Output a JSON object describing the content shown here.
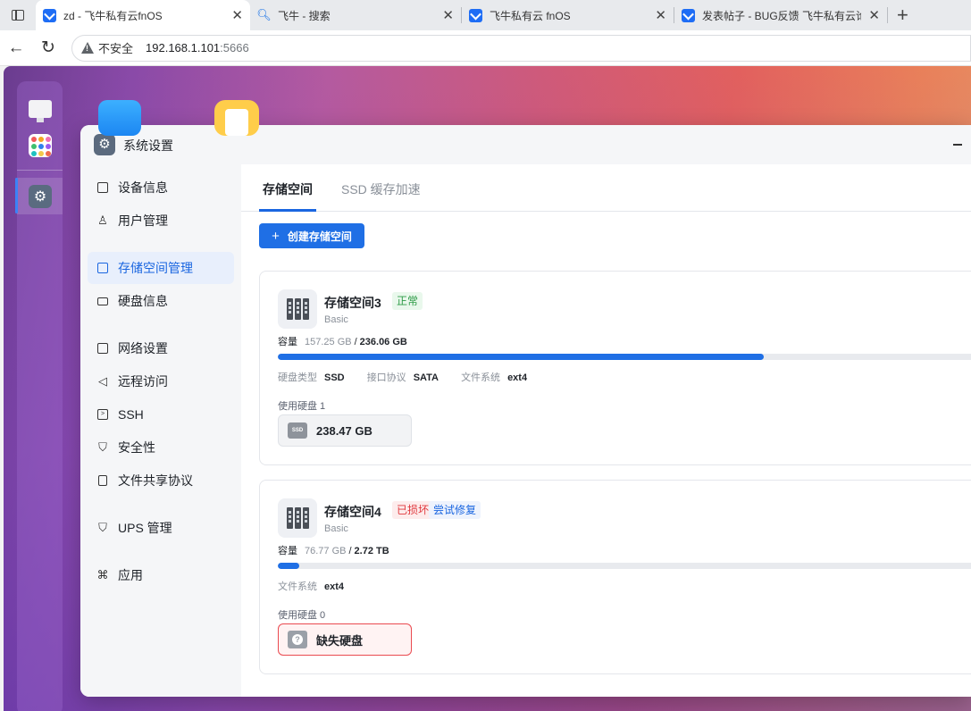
{
  "browser": {
    "tabs": [
      {
        "title": "zd - 飞牛私有云fnOS",
        "active": true
      },
      {
        "title": "飞牛 - 搜索",
        "active": false
      },
      {
        "title": "飞牛私有云 fnOS",
        "active": false
      },
      {
        "title": "发表帖子 - BUG反馈 飞牛私有云论",
        "active": false
      }
    ],
    "security_label": "不安全",
    "url_host": "192.168.1.101",
    "url_port": ":5666"
  },
  "window": {
    "title": "系统设置"
  },
  "sidebar": {
    "items": [
      {
        "label": "设备信息",
        "icon": "device-icon"
      },
      {
        "label": "用户管理",
        "icon": "user-icon"
      },
      {
        "label": "存储空间管理",
        "icon": "storage-icon",
        "active": true
      },
      {
        "label": "硬盘信息",
        "icon": "disk-icon"
      },
      {
        "label": "网络设置",
        "icon": "network-icon"
      },
      {
        "label": "远程访问",
        "icon": "remote-icon"
      },
      {
        "label": "SSH",
        "icon": "terminal-icon"
      },
      {
        "label": "安全性",
        "icon": "shield-icon"
      },
      {
        "label": "文件共享协议",
        "icon": "file-icon"
      },
      {
        "label": "UPS 管理",
        "icon": "ups-icon"
      },
      {
        "label": "应用",
        "icon": "apps-icon"
      }
    ]
  },
  "content": {
    "tabs": [
      "存储空间",
      "SSD 缓存加速"
    ],
    "create_button": "创建存储空间",
    "pools": [
      {
        "name": "存储空间3",
        "status": "正常",
        "type": "Basic",
        "capacity_label": "容量",
        "used": "157.25 GB",
        "total": "236.06 GB",
        "usage_fraction": 0.68,
        "meta": [
          {
            "key": "硬盘类型",
            "value": "SSD"
          },
          {
            "key": "接口协议",
            "value": "SATA"
          },
          {
            "key": "文件系统",
            "value": "ext4"
          }
        ],
        "disks_label": "使用硬盘 1",
        "disk_chip": "238.47 GB"
      },
      {
        "name": "存储空间4",
        "status": "已损坏",
        "repair_link": "尝试修复",
        "type": "Basic",
        "capacity_label": "容量",
        "used": "76.77 GB",
        "total": "2.72 TB",
        "usage_fraction": 0.03,
        "meta": [
          {
            "key": "文件系统",
            "value": "ext4"
          }
        ],
        "disks_label": "使用硬盘 0",
        "disk_chip": "缺失硬盘"
      }
    ]
  },
  "colors": {
    "accent": "#1f6fe5",
    "ok": "#2e9b47",
    "error": "#e0393e"
  }
}
